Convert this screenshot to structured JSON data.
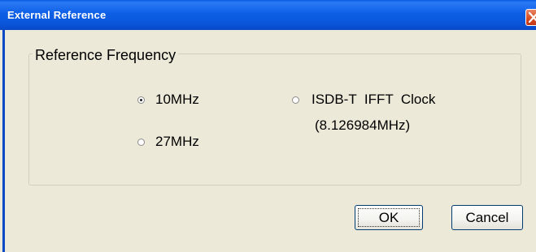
{
  "window": {
    "title": "External Reference"
  },
  "group": {
    "label": "Reference Frequency"
  },
  "options": [
    {
      "label": "10MHz",
      "selected": true
    },
    {
      "label": "27MHz",
      "selected": false
    },
    {
      "label": "ISDB-T  IFFT  Clock",
      "sublabel": "(8.126984MHz)",
      "selected": false
    }
  ],
  "buttons": {
    "ok": "OK",
    "cancel": "Cancel"
  },
  "colors": {
    "titlebar": "#0a56d9",
    "face": "#ece9d8",
    "close": "#d84a1f"
  }
}
